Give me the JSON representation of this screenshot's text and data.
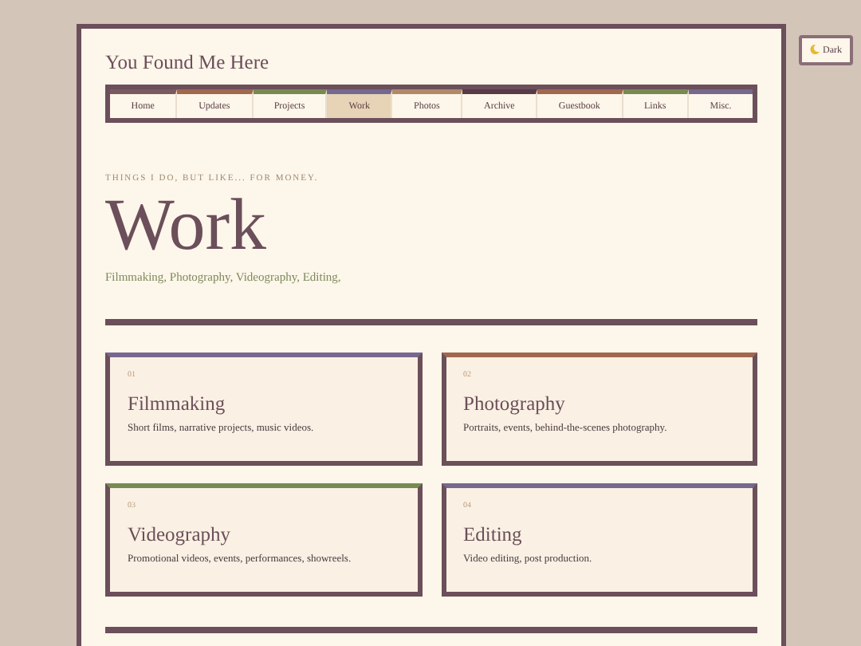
{
  "theme_toggle": {
    "label": "Dark"
  },
  "site_title": "You Found Me Here",
  "nav": [
    {
      "label": "Home",
      "selected": false,
      "color": "#7a5a60"
    },
    {
      "label": "Updates",
      "selected": false,
      "color": "#a0684e"
    },
    {
      "label": "Projects",
      "selected": false,
      "color": "#788a52"
    },
    {
      "label": "Work",
      "selected": true,
      "color": "#76688e"
    },
    {
      "label": "Photos",
      "selected": false,
      "color": "#b08a68"
    },
    {
      "label": "Archive",
      "selected": false,
      "color": "#583a48"
    },
    {
      "label": "Guestbook",
      "selected": false,
      "color": "#a0684e"
    },
    {
      "label": "Links",
      "selected": false,
      "color": "#788a52"
    },
    {
      "label": "Misc.",
      "selected": false,
      "color": "#76688e"
    }
  ],
  "eyebrow": "THINGS I DO, BUT LIKE... FOR MONEY.",
  "heading": "Work",
  "subtitle": "Filmmaking, Photography, Videography, Editing,",
  "cards": [
    {
      "number": "01",
      "title": "Filmmaking",
      "text": "Short films, narrative projects, music videos.",
      "color": "#76688e"
    },
    {
      "number": "02",
      "title": "Photography",
      "text": "Portraits, events, behind-the-scenes photography.",
      "color": "#a0684e"
    },
    {
      "number": "03",
      "title": "Videography",
      "text": "Promotional videos, events, performances, showreels.",
      "color": "#788a52"
    },
    {
      "number": "04",
      "title": "Editing",
      "text": "Video editing, post production.",
      "color": "#76688e"
    }
  ]
}
